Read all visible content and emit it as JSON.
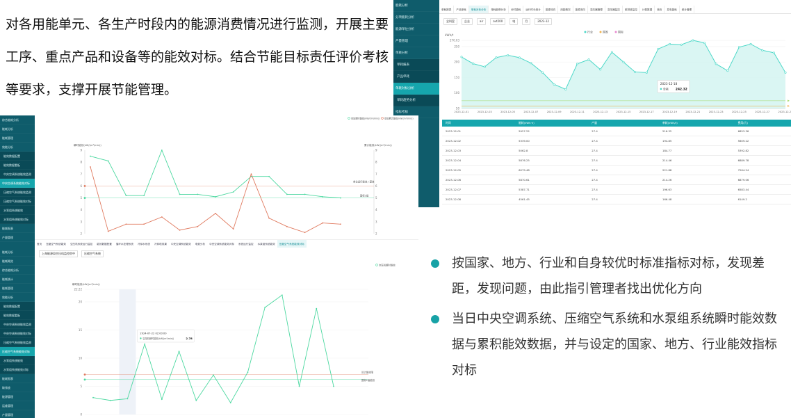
{
  "intro": {
    "lines": [
      "对各用能单元、各生产时段内的能源消费情况进行监测，开展主要",
      "工序、重点产品和设备等的能效对标。结合节能目标责任评价考核",
      "等要求，支撑开展节能管理。"
    ]
  },
  "bullets": [
    "按国家、地方、行业和自身较优时标准指标对标，发现差距，发现问题，由此指引管理者找出优化方向",
    "当日中央空调系统、压缩空气系统和水泵组系统瞬时能效数据与累积能效数据，并与设定的国家、地方、行业能效指标对标"
  ],
  "colors": {
    "teal": "#16a6ad",
    "sidebar": "#0f5c6b",
    "green": "#4cd8a0",
    "red": "#e07a5f"
  },
  "shotA": {
    "sidebar": [
      {
        "label": "能耗分析",
        "type": "top"
      },
      {
        "label": "分项能耗分析",
        "type": "top"
      },
      {
        "label": "能源单位分析",
        "type": "top"
      },
      {
        "label": "产量管理",
        "type": "top"
      },
      {
        "label": "单耗分析",
        "type": "top"
      },
      {
        "label": "单耗报表",
        "type": "sub"
      },
      {
        "label": "产品单耗",
        "type": "sub"
      },
      {
        "label": "单耗对标分析",
        "type": "act"
      },
      {
        "label": "单耗趋势分析",
        "type": "sub"
      },
      {
        "label": "指标考核",
        "type": "top"
      }
    ],
    "tabs": [
      "单耗报表",
      "产品单耗",
      "单耗对标分析",
      "单耗趋势分析",
      "分时能耗",
      "运行时长统计",
      "能源流向",
      "用能概况",
      "能源流向",
      "变压器管理",
      "变压器监控",
      "碳排放监控",
      "计费数据",
      "首页",
      "发电能耗",
      "统计管理"
    ],
    "active_tab": "单耗对标分析",
    "filters": [
      "全科室",
      "企业",
      "air",
      "avt200",
      "电",
      "月",
      "2023-12"
    ],
    "chart": {
      "ylabel": "kWh/t",
      "legend": [
        "行业",
        "国家",
        "国际"
      ],
      "tooltip_date": "2023-12-18",
      "tooltip_series": "单耗",
      "tooltip_value": "242.32"
    },
    "table": {
      "headers": [
        "时间",
        "能耗(kWh·h)",
        "产量",
        "单耗(kWh/t)",
        "费用(元)"
      ],
      "rows": [
        [
          "2023-12-01",
          "5927.22",
          "27.4",
          "216.32",
          "6853.36"
        ],
        [
          "2023-12-02",
          "5339.00",
          "27.4",
          "194.85",
          "5609.22"
        ],
        [
          "2023-12-03",
          "5062.8",
          "27.4",
          "184.77",
          "5392.82"
        ],
        [
          "2023-12-04",
          "5876.25",
          "27.4",
          "214.46",
          "6889.78"
        ],
        [
          "2023-12-05",
          "6079.48",
          "27.4",
          "221.88",
          "7264.24"
        ],
        [
          "2023-12-06",
          "5870.61",
          "27.4",
          "214.26",
          "6879.06"
        ],
        [
          "2023-12-07",
          "5387.71",
          "27.4",
          "196.63",
          "6583.44"
        ],
        [
          "2023-12-08",
          "4561.45",
          "27.4",
          "166.48",
          "6149.2"
        ]
      ]
    }
  },
  "shotB": {
    "sidebar": [
      {
        "label": "综合能耗分析",
        "type": "top"
      },
      {
        "label": "能耗分析",
        "type": "top"
      },
      {
        "label": "能耗管理",
        "type": "top"
      },
      {
        "label": "效能分析",
        "type": "top"
      },
      {
        "label": "能效数据配置",
        "type": "sub"
      },
      {
        "label": "能效数据看板",
        "type": "sub"
      },
      {
        "label": "中央空调系统能效监测",
        "type": "sub"
      },
      {
        "label": "中央空调系统能效对标",
        "type": "act"
      },
      {
        "label": "压缩空气系统能效监测",
        "type": "sub"
      },
      {
        "label": "压缩空气系统能效对标",
        "type": "sub"
      },
      {
        "label": "水泵组系统能效",
        "type": "sub"
      },
      {
        "label": "水泵组系统能效对标",
        "type": "sub"
      },
      {
        "label": "能耗报表",
        "type": "top"
      },
      {
        "label": "产量管理",
        "type": "top"
      }
    ],
    "tabs": [
      "首页",
      "压缩空气系统能效",
      "空压机系统运行监控",
      "能效数据配置",
      "循环水处理系统",
      "冷却水系统",
      "冷却塔效果",
      "中央空调系统能效",
      "电费分析",
      "中央空调系统能效对标",
      "系统运行监控",
      "水泵组系统能效",
      "压缩空气系统能效对标"
    ],
    "active_tab": "压缩空气系统能效对标",
    "chart": {
      "ylabel": "瞬时能效(kW/(m³/min))",
      "ylabel_right": "累计能效(kW/(m³/min))",
      "legend": [
        "空压瞬时能效(kW/(m³/min))",
        "空压累计能效(kW/(m³/min))"
      ],
      "ref_upper_label": "单位运行能效 / 基准",
      "ref_lower_label": "国标1级"
    }
  },
  "shotC": {
    "sidebar": [
      {
        "label": "能耗分析",
        "type": "top"
      },
      {
        "label": "能耗概览",
        "type": "top"
      },
      {
        "label": "综合能耗分析",
        "type": "top"
      },
      {
        "label": "能耗统计",
        "type": "top"
      },
      {
        "label": "能耗管理",
        "type": "top"
      },
      {
        "label": "效能分析",
        "type": "top"
      },
      {
        "label": "能效数据配置",
        "type": "sub"
      },
      {
        "label": "能效数据看板",
        "type": "sub"
      },
      {
        "label": "中央空调系统能效监测",
        "type": "sub"
      },
      {
        "label": "中央空调系统能效对标",
        "type": "sub"
      },
      {
        "label": "压缩空气系统能效监测",
        "type": "sub"
      },
      {
        "label": "压缩空气系统能效对标",
        "type": "act"
      },
      {
        "label": "水泵组系统能效",
        "type": "sub"
      },
      {
        "label": "水泵组系统能效对标",
        "type": "sub"
      },
      {
        "label": "能耗报表",
        "type": "top"
      },
      {
        "label": "碳排放",
        "type": "top"
      },
      {
        "label": "能源管理",
        "type": "top"
      },
      {
        "label": "运维管理",
        "type": "top"
      },
      {
        "label": "产量管理",
        "type": "top"
      }
    ],
    "filters": [
      "上海能源局空压机监控房中",
      "压缩空气系统"
    ],
    "chart": {
      "ylabel": "瞬时能效(kW/(m³/min))",
      "legend": "空压机瞬时能效",
      "tooltip_time": "2024-07-22 02:00:00",
      "tooltip_series": "空压机瞬时能效(kW/(m³/min))",
      "tooltip_value": "2.78",
      "ref_upper_label": "设计能效限",
      "ref_lower_label": "国标1级能效"
    }
  },
  "chart_data": [
    {
      "type": "line",
      "title": "",
      "ylabel": "kWh/t",
      "ylim": [
        50,
        270.03
      ],
      "x": [
        "2023-12-01",
        "2023-12-02",
        "2023-12-03",
        "2023-12-04",
        "2023-12-05",
        "2023-12-06",
        "2023-12-07",
        "2023-12-08",
        "2023-12-09",
        "2023-12-10",
        "2023-12-11",
        "2023-12-12",
        "2023-12-13",
        "2023-12-14",
        "2023-12-15",
        "2023-12-16",
        "2023-12-17",
        "2023-12-18",
        "2023-12-19",
        "2023-12-20",
        "2023-12-21",
        "2023-12-22",
        "2023-12-23",
        "2023-12-24",
        "2023-12-25",
        "2023-12-26",
        "2023-12-27",
        "2023-12-28",
        "2023-12-29"
      ],
      "xticks": [
        "2023-12-01",
        "2023-12-03",
        "2023-12-05",
        "2023-12-07",
        "2023-12-09",
        "2023-12-11",
        "2023-12-13",
        "2023-12-15",
        "2023-12-17",
        "2023-12-19",
        "2023-12-21",
        "2023-12-23",
        "2023-12-25",
        "2023-12-27",
        "2023-12-29"
      ],
      "yticks": [
        270.03,
        250,
        200,
        150,
        100,
        50
      ],
      "series": [
        {
          "name": "单耗",
          "values": [
            216.32,
            194.85,
            184.77,
            214.46,
            221.88,
            214.26,
            196.63,
            166.48,
            128,
            112,
            194,
            208,
            176,
            232,
            200,
            168,
            166,
            242.32,
            258,
            256,
            270.03,
            262,
            194,
            172,
            248,
            258,
            238,
            230,
            166
          ],
          "color": "#4cd8c8"
        },
        {
          "name": "行业",
          "values": [
            75
          ],
          "color": "#a4d86a"
        },
        {
          "name": "国家",
          "values": [
            58
          ],
          "color": "#f0b24d"
        }
      ]
    },
    {
      "type": "line",
      "title": "",
      "xlabel": "",
      "ylabel": "瞬时能效(kW/(m³/min))",
      "ylim": [
        2,
        9
      ],
      "yticks": [
        9,
        8,
        7,
        6,
        5,
        4,
        3,
        2
      ],
      "series": [
        {
          "name": "空压瞬时能效(kW/(m³/min))",
          "values": [
            8.5,
            8.1,
            5.2,
            5.2,
            9,
            5.3,
            5.3,
            5.1,
            5.5,
            6.8,
            6.8,
            5.3,
            5.3,
            5.1,
            5.0
          ],
          "color": "#4cd8a0"
        },
        {
          "name": "空压累计能效(kW/(m³/min))",
          "values": [
            7.6,
            2.2,
            2.8,
            2.8,
            3.4,
            2.3,
            2.6,
            3.7,
            2.4,
            7.0,
            3.3,
            2.6,
            2.1,
            2.9,
            2.8
          ],
          "color": "#e07a5f"
        },
        {
          "name": "单位运行能效 / 基准",
          "values": [
            6.0
          ],
          "color": "#e07a5f"
        },
        {
          "name": "国标1级",
          "values": [
            5.0
          ],
          "color": "#4cd8a0"
        }
      ]
    },
    {
      "type": "line",
      "title": "",
      "ylabel": "瞬时能效(kW/(m³/min))",
      "ylim": [
        0,
        22.22
      ],
      "yticks": [
        22.22,
        20,
        15,
        10,
        5,
        0
      ],
      "series": [
        {
          "name": "空压机瞬时能效",
          "values": [
            3,
            2.5,
            2.8,
            12.5,
            2.7,
            11.2,
            2.5,
            7,
            2.1,
            7.5,
            19,
            21.2,
            5,
            18.8,
            5
          ],
          "color": "#4cd8a0"
        },
        {
          "name": "设计能效限",
          "values": [
            7.1
          ],
          "color": "#e07a5f"
        },
        {
          "name": "国标1级能效",
          "values": [
            6.2
          ],
          "color": "#4cd8a0"
        }
      ]
    }
  ]
}
